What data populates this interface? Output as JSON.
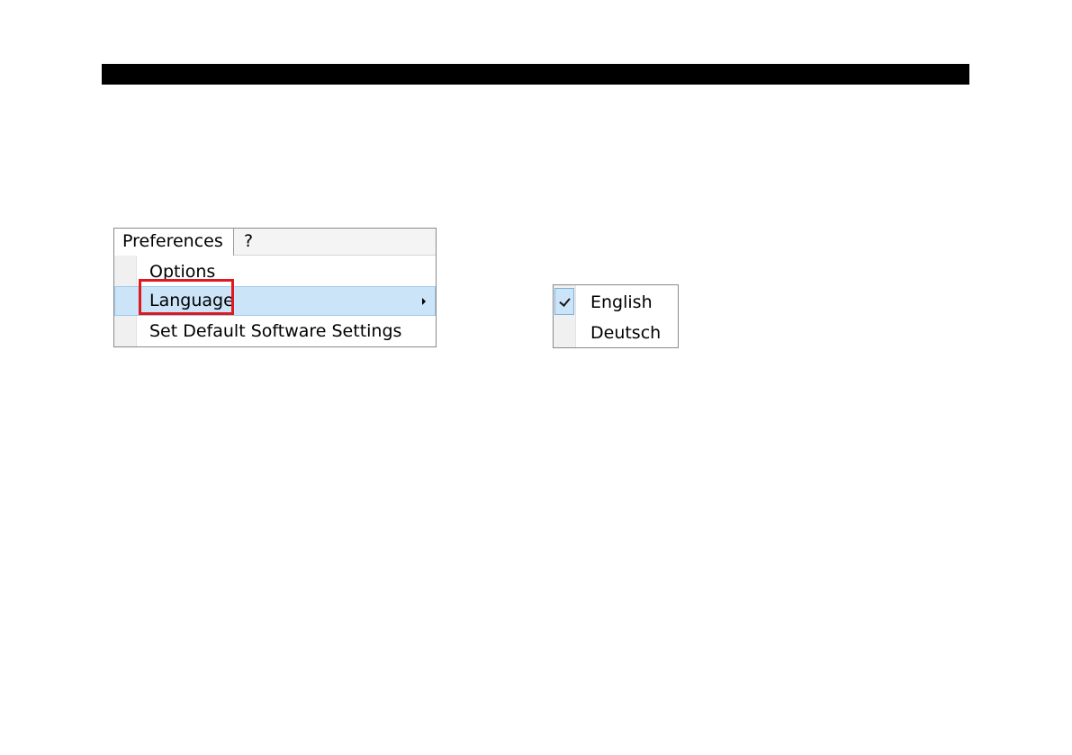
{
  "menu": {
    "bar": {
      "preferences": "Preferences",
      "help": "?"
    },
    "items": [
      {
        "label": "Options"
      },
      {
        "label": "Language",
        "has_submenu": true,
        "highlighted": true
      },
      {
        "label": "Set Default Software Settings"
      }
    ]
  },
  "language_submenu": {
    "items": [
      {
        "label": "English",
        "checked": true
      },
      {
        "label": "Deutsch",
        "checked": false
      }
    ]
  },
  "colors": {
    "highlight_box": "#e0191f",
    "selected_background": "#cce4f7",
    "top_bar": "#000000"
  }
}
